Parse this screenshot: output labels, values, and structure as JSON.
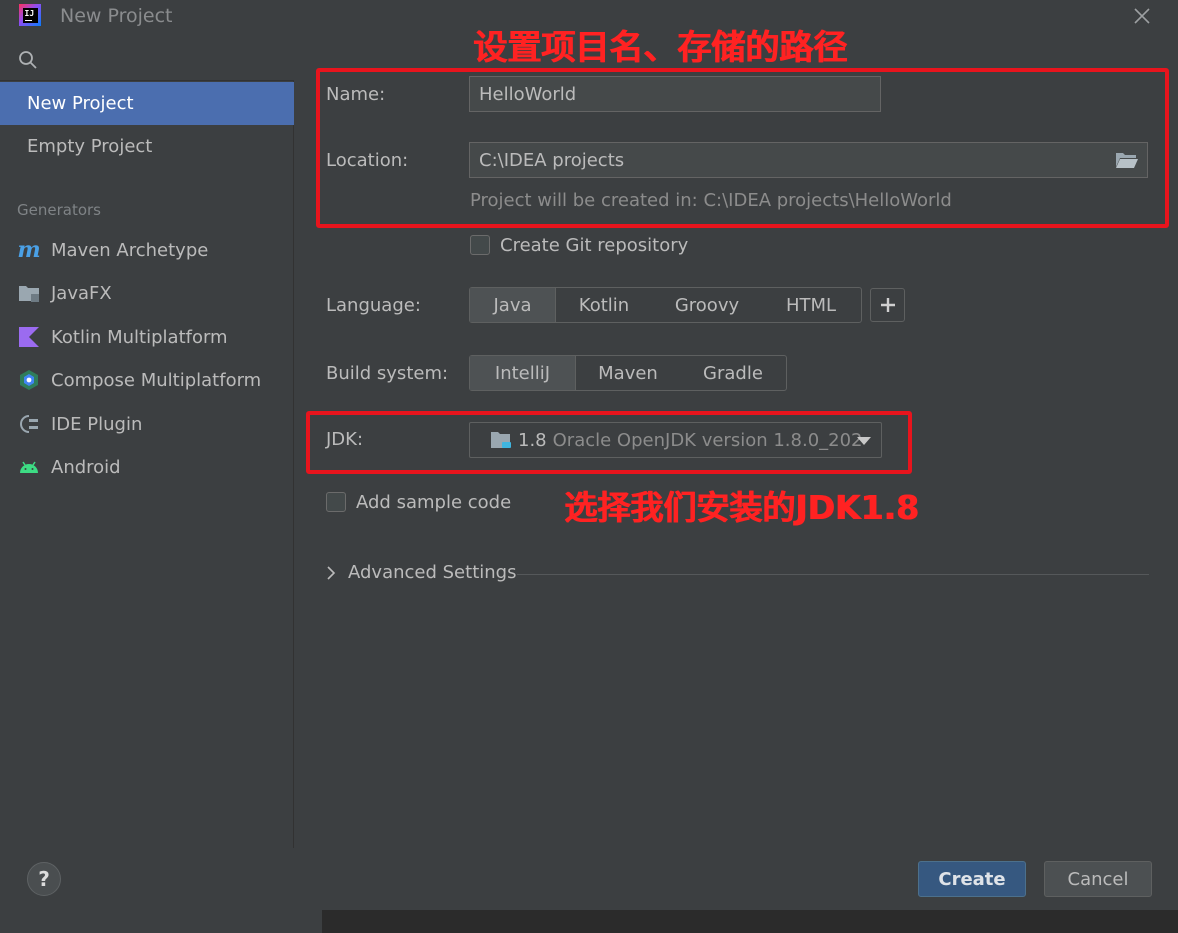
{
  "window": {
    "title": "New Project",
    "close_icon": "close-icon"
  },
  "sidebar": {
    "search_icon": "search-icon",
    "items": [
      {
        "label": "New Project",
        "selected": true
      },
      {
        "label": "Empty Project",
        "selected": false
      }
    ],
    "generators_title": "Generators",
    "generators": [
      {
        "label": "Maven Archetype",
        "icon": "maven-icon"
      },
      {
        "label": "JavaFX",
        "icon": "javafx-icon"
      },
      {
        "label": "Kotlin Multiplatform",
        "icon": "kotlin-icon"
      },
      {
        "label": "Compose Multiplatform",
        "icon": "compose-icon"
      },
      {
        "label": "IDE Plugin",
        "icon": "plugin-icon"
      },
      {
        "label": "Android",
        "icon": "android-icon"
      }
    ]
  },
  "form": {
    "name_label": "Name:",
    "name_value": "HelloWorld",
    "location_label": "Location:",
    "location_value": "C:\\IDEA projects",
    "location_hint": "Project will be created in: C:\\IDEA projects\\HelloWorld",
    "git_label": "Create Git repository",
    "git_checked": false,
    "language_label": "Language:",
    "languages": [
      "Java",
      "Kotlin",
      "Groovy",
      "HTML"
    ],
    "language_selected": "Java",
    "build_label": "Build system:",
    "build_systems": [
      "IntelliJ",
      "Maven",
      "Gradle"
    ],
    "build_selected": "IntelliJ",
    "jdk_label": "JDK:",
    "jdk_version": "1.8",
    "jdk_detail": "Oracle OpenJDK version 1.8.0_202",
    "sample_label": "Add sample code",
    "sample_checked": false,
    "advanced_label": "Advanced Settings"
  },
  "annotations": {
    "top_note": "设置项目名、存储的路径",
    "jdk_note": "选择我们安装的JDK1.8",
    "color": "#e8141d"
  },
  "footer": {
    "help_label": "?",
    "create_label": "Create",
    "cancel_label": "Cancel"
  },
  "colors": {
    "background": "#3c3f41",
    "selected": "#4b6eaf",
    "primary_button": "#365880"
  }
}
